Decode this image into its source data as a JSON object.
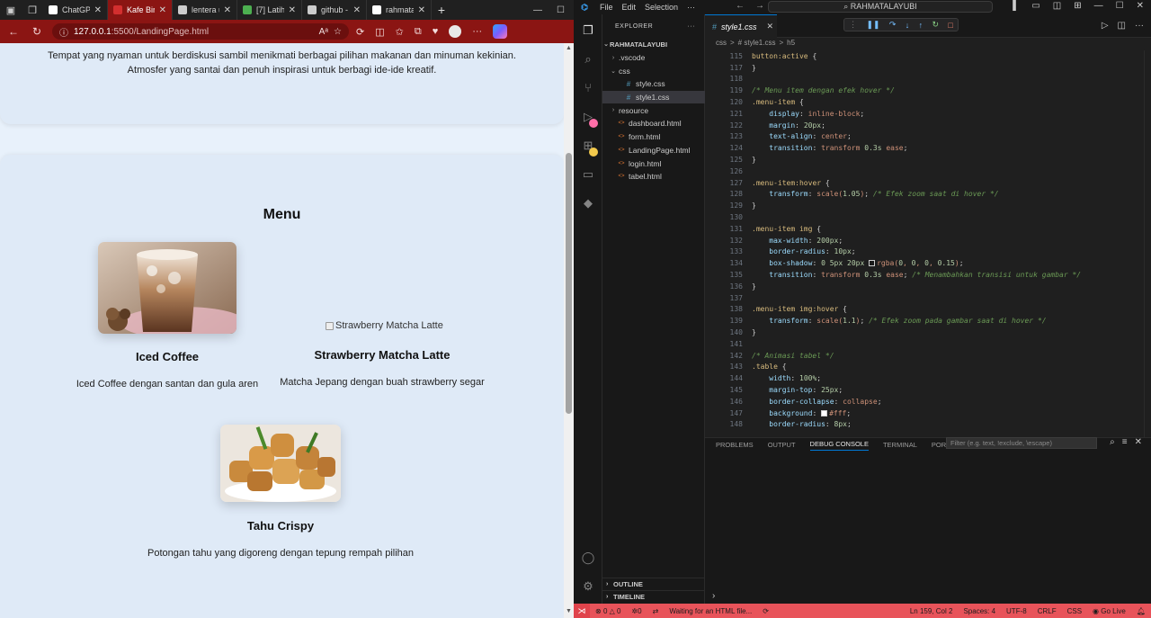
{
  "browser": {
    "tabs": [
      {
        "label": "ChatGPT",
        "icon": "chatgpt-icon",
        "color": "#ffffff"
      },
      {
        "label": "Kafe Biru",
        "icon": "page-icon",
        "color": "#d32f2f",
        "active": true
      },
      {
        "label": "lentera u",
        "icon": "search-icon",
        "color": "#cccccc"
      },
      {
        "label": "[7] Latih",
        "icon": "drive-icon",
        "color": "#4caf50"
      },
      {
        "label": "github -",
        "icon": "search-icon",
        "color": "#cccccc"
      },
      {
        "label": "rahmatal",
        "icon": "github-icon",
        "color": "#ffffff"
      }
    ],
    "url": "127.0.0.1:5500/LandingPage.html",
    "url_host": "127.0.0.1",
    "url_rest": ":5500/LandingPage.html"
  },
  "page": {
    "about_text": "Tempat yang nyaman untuk berdiskusi sambil menikmati berbagai pilihan makanan dan minuman kekinian. Atmosfer yang santai dan penuh inspirasi untuk berbagi ide-ide kreatif.",
    "menu_title": "Menu",
    "items": [
      {
        "name": "Iced Coffee",
        "desc": "Iced Coffee dengan santan dan gula aren"
      },
      {
        "name": "Strawberry Matcha Latte",
        "desc": "Matcha Jepang dengan buah strawberry segar",
        "alt": "Strawberry Matcha Latte"
      },
      {
        "name": "Tahu Crispy",
        "desc": "Potongan tahu yang digoreng dengan tepung rempah pilihan"
      }
    ]
  },
  "vscode": {
    "menu": [
      "File",
      "Edit",
      "Selection",
      "···"
    ],
    "command_center": "RAHMATALAYUBI",
    "explorer_title": "EXPLORER",
    "root_folder": "RAHMATALAYUBI",
    "tree": [
      {
        "label": ".vscode",
        "type": "folder",
        "indent": 1,
        "open": false
      },
      {
        "label": "css",
        "type": "folder",
        "indent": 1,
        "open": true
      },
      {
        "label": "style.css",
        "type": "css",
        "indent": 2
      },
      {
        "label": "style1.css",
        "type": "css",
        "indent": 2,
        "selected": true
      },
      {
        "label": "resource",
        "type": "folder",
        "indent": 1,
        "open": false
      },
      {
        "label": "dashboard.html",
        "type": "html",
        "indent": 1
      },
      {
        "label": "form.html",
        "type": "html",
        "indent": 1
      },
      {
        "label": "LandingPage.html",
        "type": "html",
        "indent": 1
      },
      {
        "label": "login.html",
        "type": "html",
        "indent": 1
      },
      {
        "label": "tabel.html",
        "type": "html",
        "indent": 1
      }
    ],
    "outline_label": "OUTLINE",
    "timeline_label": "TIMELINE",
    "editor_tab": "style1.css",
    "breadcrumbs": [
      "css",
      ">",
      "# style1.css",
      ">",
      "h5"
    ],
    "code_lines": [
      {
        "n": "115",
        "t": "button:active {"
      },
      {
        "n": "117",
        "t": "}"
      },
      {
        "n": "118",
        "t": ""
      },
      {
        "n": "119",
        "t": "/* Menu item dengan efek hover */"
      },
      {
        "n": "120",
        "t": ".menu-item {"
      },
      {
        "n": "121",
        "t": "    display: inline-block;"
      },
      {
        "n": "122",
        "t": "    margin: 20px;"
      },
      {
        "n": "123",
        "t": "    text-align: center;"
      },
      {
        "n": "124",
        "t": "    transition: transform 0.3s ease;"
      },
      {
        "n": "125",
        "t": "}"
      },
      {
        "n": "126",
        "t": ""
      },
      {
        "n": "127",
        "t": ".menu-item:hover {"
      },
      {
        "n": "128",
        "t": "    transform: scale(1.05); /* Efek zoom saat di hover */"
      },
      {
        "n": "129",
        "t": "}"
      },
      {
        "n": "130",
        "t": ""
      },
      {
        "n": "131",
        "t": ".menu-item img {"
      },
      {
        "n": "132",
        "t": "    max-width: 200px;"
      },
      {
        "n": "133",
        "t": "    border-radius: 10px;"
      },
      {
        "n": "134",
        "t": "    box-shadow: 0 5px 20px rgba(0, 0, 0, 0.15);"
      },
      {
        "n": "135",
        "t": "    transition: transform 0.3s ease; /* Menambahkan transisi untuk gambar */"
      },
      {
        "n": "136",
        "t": "}"
      },
      {
        "n": "137",
        "t": ""
      },
      {
        "n": "138",
        "t": ".menu-item img:hover {"
      },
      {
        "n": "139",
        "t": "    transform: scale(1.1); /* Efek zoom pada gambar saat di hover */"
      },
      {
        "n": "140",
        "t": "}"
      },
      {
        "n": "141",
        "t": ""
      },
      {
        "n": "142",
        "t": "/* Animasi tabel */"
      },
      {
        "n": "143",
        "t": ".table {"
      },
      {
        "n": "144",
        "t": "    width: 100%;"
      },
      {
        "n": "145",
        "t": "    margin-top: 25px;"
      },
      {
        "n": "146",
        "t": "    border-collapse: collapse;"
      },
      {
        "n": "147",
        "t": "    background: #fff;"
      },
      {
        "n": "148",
        "t": "    border-radius: 8px;"
      }
    ],
    "panel_tabs": [
      "PROBLEMS",
      "OUTPUT",
      "DEBUG CONSOLE",
      "TERMINAL",
      "PORTS"
    ],
    "panel_active": "DEBUG CONSOLE",
    "filter_placeholder": "Filter (e.g. text, !exclude, \\escape)",
    "status": {
      "errors": "0",
      "warnings": "0",
      "info": "0",
      "message": "Waiting for an HTML file...",
      "position": "Ln 159, Col 2",
      "spaces": "Spaces: 4",
      "encoding": "UTF-8",
      "eol": "CRLF",
      "language": "CSS",
      "golive": "Go Live"
    },
    "status_color": "#e8535a"
  }
}
